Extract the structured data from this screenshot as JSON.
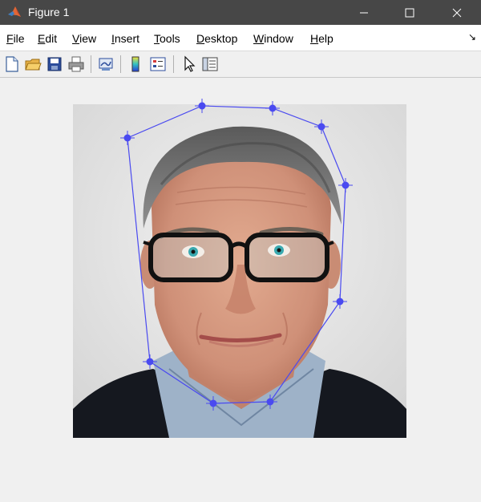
{
  "window": {
    "title": "Figure 1",
    "app_icon": "matlab-icon",
    "controls": [
      "minimize-icon",
      "maximize-icon",
      "close-icon"
    ]
  },
  "menubar": {
    "items": [
      {
        "label": "File",
        "mnemonic": "F"
      },
      {
        "label": "Edit",
        "mnemonic": "E"
      },
      {
        "label": "View",
        "mnemonic": "V"
      },
      {
        "label": "Insert",
        "mnemonic": "I"
      },
      {
        "label": "Tools",
        "mnemonic": "T"
      },
      {
        "label": "Desktop",
        "mnemonic": "D"
      },
      {
        "label": "Window",
        "mnemonic": "W"
      },
      {
        "label": "Help",
        "mnemonic": "H"
      }
    ]
  },
  "toolbar": {
    "buttons": [
      "new-figure-icon",
      "open-file-icon",
      "save-icon",
      "print-icon",
      "link-plot-icon",
      "colorbar-icon",
      "legend-icon",
      "edit-plot-icon",
      "property-inspector-icon"
    ]
  },
  "figure": {
    "image_subject": "portrait photo of a man with glasses",
    "overlay": {
      "type": "polygon",
      "color": "#4a4af0"
    }
  }
}
